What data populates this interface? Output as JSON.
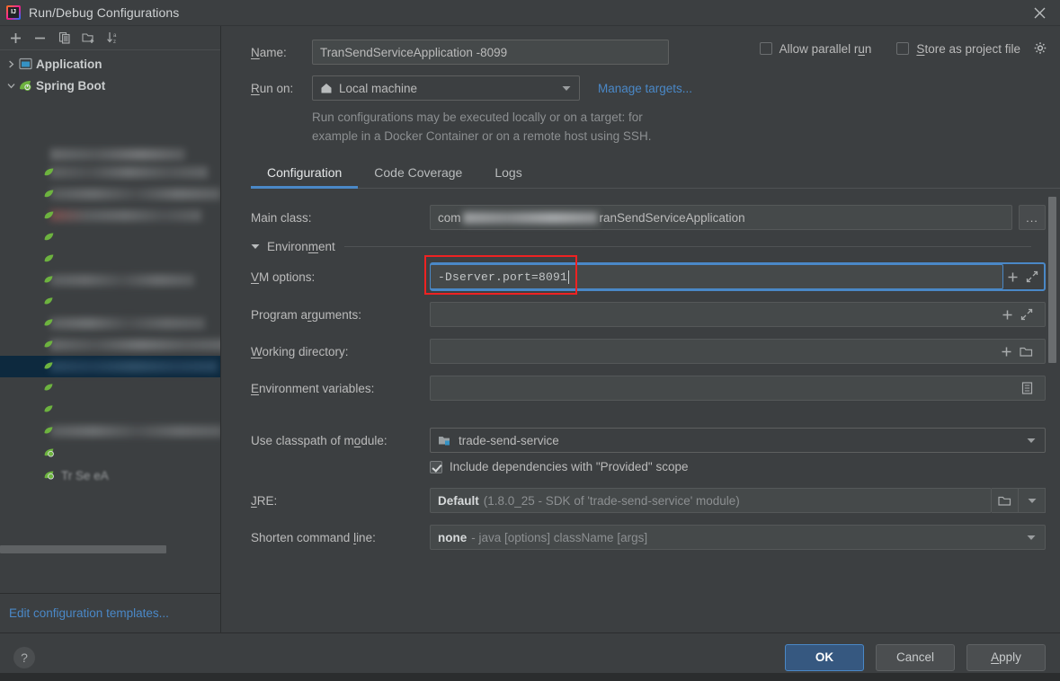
{
  "window": {
    "title": "Run/Debug Configurations",
    "app_icon": "intellij-idea-icon",
    "close_icon": "close-icon"
  },
  "tree_toolbar": {
    "buttons": [
      {
        "name": "add-configuration-button",
        "icon": "plus-icon"
      },
      {
        "name": "remove-configuration-button",
        "icon": "minus-icon"
      },
      {
        "name": "copy-configuration-button",
        "icon": "copy-icon"
      },
      {
        "name": "new-folder-button",
        "icon": "new-folder-icon"
      },
      {
        "name": "sort-configurations-button",
        "icon": "sort-alphabetically-icon"
      }
    ]
  },
  "tree": {
    "nodes": [
      {
        "label": "Application",
        "icon": "application-icon",
        "expanded": false,
        "twisty": "chevron-right-icon"
      },
      {
        "label": "Spring Boot",
        "icon": "spring-boot-icon",
        "expanded": true,
        "twisty": "chevron-down-icon"
      }
    ],
    "redacted_note": "configuration list items are blurred",
    "partial_label": "Tr        Se     eA",
    "edit_templates_link": "Edit configuration templates..."
  },
  "header": {
    "name_label": "Name:",
    "name_value": "TranSendServiceApplication -8099",
    "allow_parallel_run": {
      "label": "Allow parallel run",
      "checked": false
    },
    "store_as_project_file": {
      "label": "Store as project file",
      "checked": false,
      "gear_icon": "gear-icon"
    },
    "run_on_label": "Run on:",
    "run_on_value": "Local machine",
    "run_on_icon": "home-icon",
    "manage_targets_link": "Manage targets...",
    "hint_line1": "Run configurations may be executed locally or on a target: for",
    "hint_line2": "example in a Docker Container or on a remote host using SSH."
  },
  "tabs": [
    {
      "label": "Configuration",
      "active": true
    },
    {
      "label": "Code Coverage",
      "active": false
    },
    {
      "label": "Logs",
      "active": false
    }
  ],
  "form": {
    "main_class": {
      "label": "Main class:",
      "value_prefix": "com",
      "value_suffix": "ranSendServiceApplication",
      "browse_label": "...",
      "redacted": true
    },
    "environment_section": {
      "label": "Environment",
      "expanded": true,
      "twisty": "triangle-down-icon"
    },
    "vm_options": {
      "label": "VM options:",
      "value": "-Dserver.port=8091",
      "focused": true,
      "annotated": true,
      "annotation_color": "#ee2222",
      "expand_icon": "expand-icon",
      "macro_icon": "plus-icon"
    },
    "program_arguments": {
      "label": "Program arguments:",
      "value": "",
      "expand_icon": "expand-icon",
      "macro_icon": "plus-icon"
    },
    "working_directory": {
      "label": "Working directory:",
      "value": "",
      "browse_icon": "folder-icon",
      "macro_icon": "plus-icon"
    },
    "environment_variables": {
      "label": "Environment variables:",
      "value": "",
      "browse_icon": "list-icon"
    },
    "use_classpath_of_module": {
      "label": "Use classpath of module:",
      "value": "trade-send-service",
      "icon": "module-icon",
      "arrow_icon": "chevron-down-icon"
    },
    "include_provided": {
      "label": "Include dependencies with \"Provided\" scope",
      "checked": true
    },
    "jre": {
      "label": "JRE:",
      "value_bold": "Default",
      "value_dim": "(1.8.0_25 - SDK of 'trade-send-service' module)",
      "browse_icon": "folder-icon",
      "arrow_icon": "chevron-down-icon"
    },
    "shorten_command_line": {
      "label": "Shorten command line:",
      "value_bold": "none",
      "value_dim": "- java [options] className [args]",
      "arrow_icon": "chevron-down-icon"
    }
  },
  "footer": {
    "help_label": "?",
    "ok_label": "OK",
    "cancel_label": "Cancel",
    "apply_label": "Apply"
  },
  "colors": {
    "background": "#3c3f41",
    "accent_blue": "#4a88c7",
    "link_blue": "#4a88c7",
    "primary_button": "#365880",
    "annotation_red": "#ee2222",
    "selection_blue": "#0d293e"
  }
}
